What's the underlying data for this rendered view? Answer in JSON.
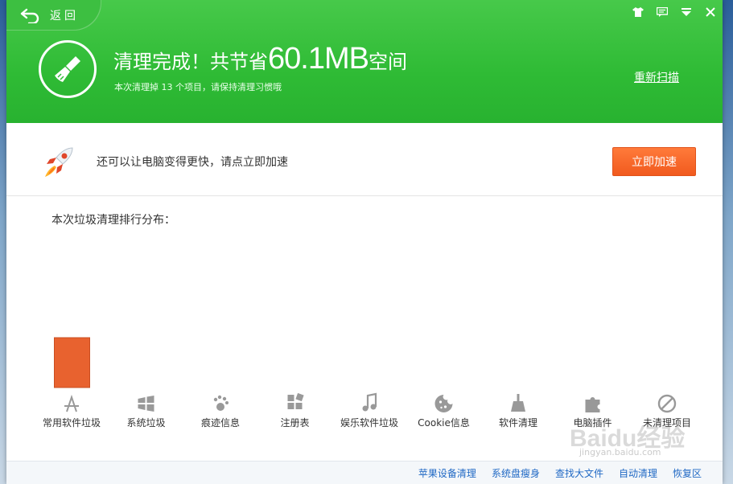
{
  "header": {
    "back_label": "返回",
    "title_prefix": "清理完成！共节省",
    "title_amount": "60.1MB",
    "title_suffix": "空间",
    "subtitle": "本次清理掉 13 个项目，请保持清理习惯哦",
    "rescan_label": "重新扫描"
  },
  "window_controls": [
    "skin-icon",
    "feedback-icon",
    "menu-icon",
    "close-icon"
  ],
  "speed": {
    "message": "还可以让电脑变得更快，请点立即加速",
    "button_label": "立即加速"
  },
  "distribution": {
    "title": "本次垃圾清理排行分布："
  },
  "chart_data": {
    "type": "bar",
    "categories": [
      "常用软件垃圾",
      "系统垃圾",
      "痕迹信息",
      "注册表",
      "娱乐软件垃圾",
      "Cookie信息",
      "软件清理",
      "电脑插件",
      "未清理项目"
    ],
    "icons": [
      "app-store-icon",
      "windows-icon",
      "footprint-icon",
      "registry-icon",
      "music-icon",
      "cookie-icon",
      "broom-icon",
      "plugin-icon",
      "forbidden-icon"
    ],
    "values": [
      1,
      0,
      0,
      0,
      0,
      0,
      0,
      0,
      0
    ],
    "bar_color": "#e8622f",
    "ylim": [
      0,
      1
    ]
  },
  "footer": {
    "links": [
      "苹果设备清理",
      "系统盘瘦身",
      "查找大文件",
      "自动清理",
      "恢复区"
    ]
  },
  "watermark": {
    "text": "Baidu经验",
    "sub": "jingyan.baidu.com"
  },
  "colors": {
    "header_green": "#2fbb35",
    "accent_orange": "#f15a1e",
    "link_blue": "#1f68c4"
  }
}
